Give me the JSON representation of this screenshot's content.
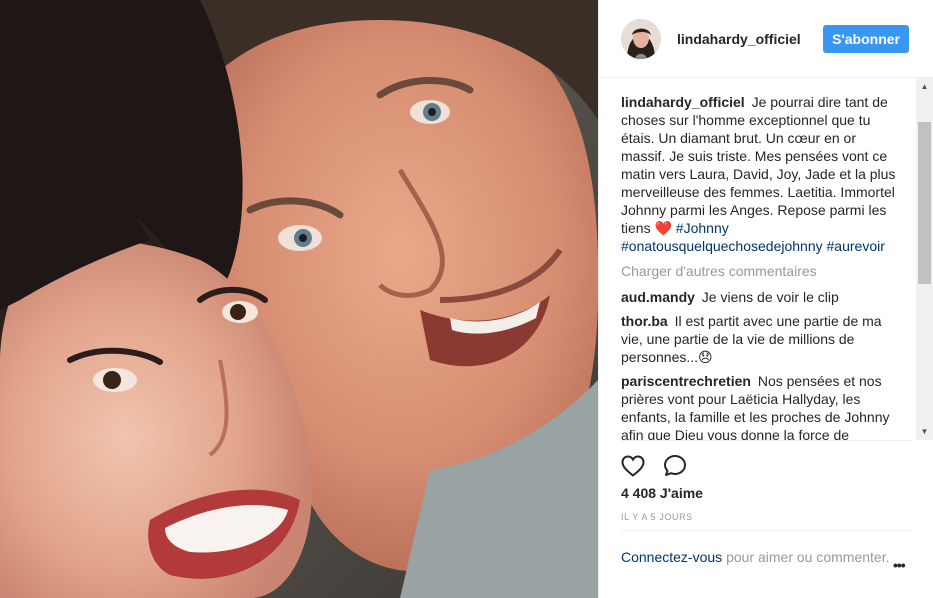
{
  "header": {
    "username": "lindahardy_officiel",
    "follow_label": "S'abonner"
  },
  "caption": {
    "author": "lindahardy_officiel",
    "text": "Je pourrai dire tant de choses sur l'homme exceptionnel que tu étais. Un diamant brut. Un cœur en or massif. Je suis triste. Mes pensées vont ce matin vers Laura, David, Joy, Jade et la plus merveilleuse des femmes. Laetitia. Immortel Johnny parmi les Anges. Repose parmi les tiens",
    "heart_emoji": "❤️",
    "hashtags": [
      "#Johnny",
      "#onatousquelquechosedejohnny",
      "#aurevoir"
    ]
  },
  "load_more_label": "Charger d'autres commentaires",
  "comments": [
    {
      "author": "aud.mandy",
      "text": "Je viens de voir le clip"
    },
    {
      "author": "thor.ba",
      "text": "Il est partit avec une partie de ma vie, une partie de la vie de millions de personnes...😞"
    },
    {
      "author": "pariscentrechretien",
      "text": "Nos pensées et nos prières vont pour Laëticia Hallyday, les enfants, la famille et les proches de Johnny afin que Dieu vous donne la force de"
    }
  ],
  "icons": {
    "like": "heart-outline-icon",
    "comment": "speech-bubble-icon",
    "more": "more-options-icon"
  },
  "likes_text": "4 408 J'aime",
  "time_text": "IL Y A 5 JOURS",
  "footer": {
    "login_link": "Connectez-vous",
    "rest": "pour aimer ou commenter."
  },
  "colors": {
    "accent": "#3897f0",
    "link": "#003569",
    "muted": "#999999",
    "heart": "#ed4956"
  }
}
